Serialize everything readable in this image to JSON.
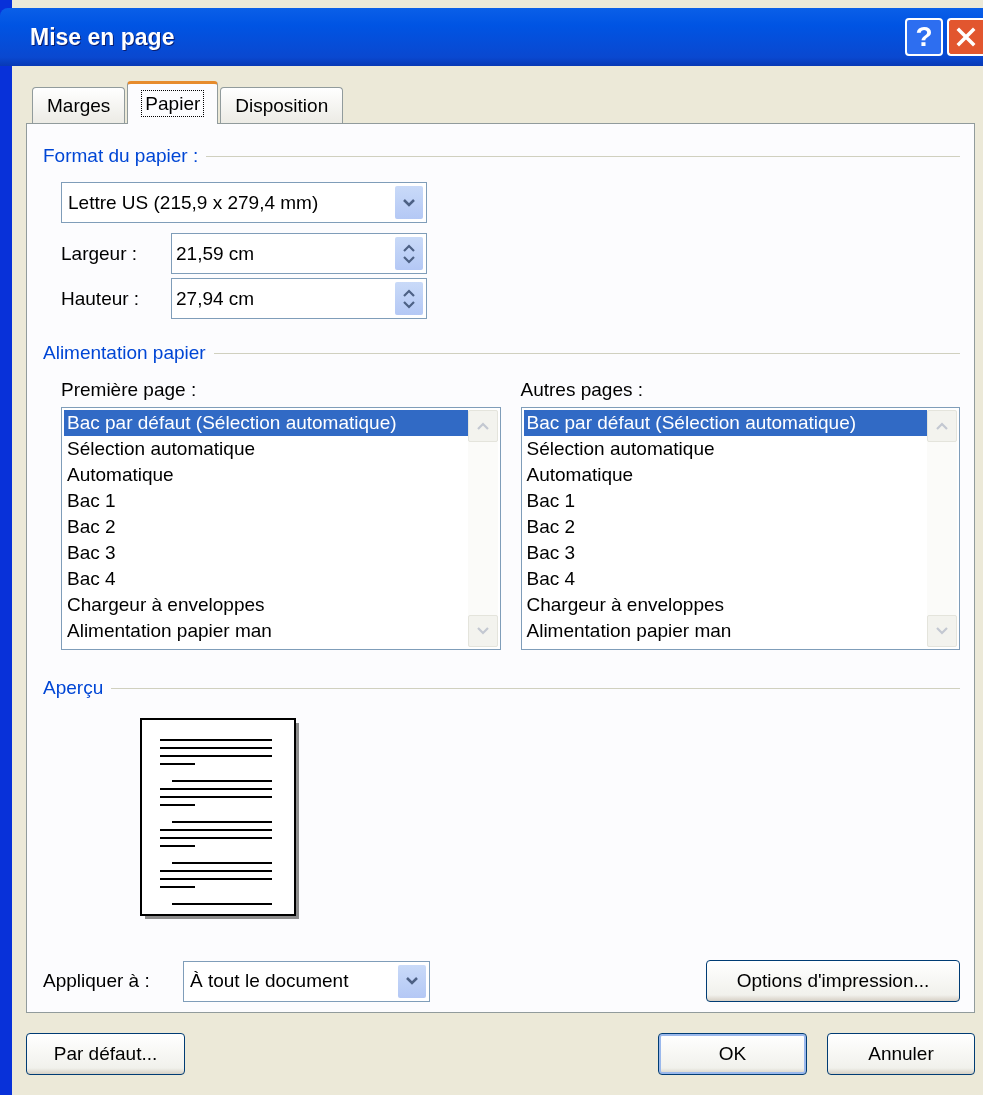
{
  "window": {
    "title": "Mise en page",
    "help_button": "?"
  },
  "tabs": [
    {
      "label": "Marges",
      "selected": false
    },
    {
      "label": "Papier",
      "selected": true
    },
    {
      "label": "Disposition",
      "selected": false
    }
  ],
  "paper_format": {
    "label": "Format du papier :",
    "size": "Lettre US (215,9 x 279,4 mm)",
    "fields": [
      {
        "label": "Largeur :",
        "value": "21,59 cm"
      },
      {
        "label": "Hauteur :",
        "value": "27,94 cm"
      }
    ]
  },
  "paper_source": {
    "label": "Alimentation papier",
    "lists": [
      {
        "label": "Première page :",
        "items": [
          {
            "text": "Bac par défaut (Sélection automatique)",
            "selected": true
          },
          {
            "text": "Sélection automatique",
            "selected": false
          },
          {
            "text": "Automatique",
            "selected": false
          },
          {
            "text": "Bac 1",
            "selected": false
          },
          {
            "text": "Bac 2",
            "selected": false
          },
          {
            "text": "Bac 3",
            "selected": false
          },
          {
            "text": "Bac 4",
            "selected": false
          },
          {
            "text": "Chargeur à enveloppes",
            "selected": false
          },
          {
            "text": "Alimentation papier man",
            "selected": false
          }
        ]
      },
      {
        "label": "Autres pages :",
        "items": [
          {
            "text": "Bac par défaut (Sélection automatique)",
            "selected": true
          },
          {
            "text": "Sélection automatique",
            "selected": false
          },
          {
            "text": "Automatique",
            "selected": false
          },
          {
            "text": "Bac 1",
            "selected": false
          },
          {
            "text": "Bac 2",
            "selected": false
          },
          {
            "text": "Bac 3",
            "selected": false
          },
          {
            "text": "Bac 4",
            "selected": false
          },
          {
            "text": "Chargeur à enveloppes",
            "selected": false
          },
          {
            "text": "Alimentation papier man",
            "selected": false
          }
        ]
      }
    ]
  },
  "preview": {
    "label": "Aperçu"
  },
  "apply_to": {
    "label": "Appliquer à :",
    "value": "À tout le document"
  },
  "print_options_button": "Options d'impression...",
  "buttons": [
    {
      "label": "Par défaut...",
      "default": false
    },
    {
      "label": "OK",
      "default": true
    },
    {
      "label": "Annuler",
      "default": false
    }
  ]
}
